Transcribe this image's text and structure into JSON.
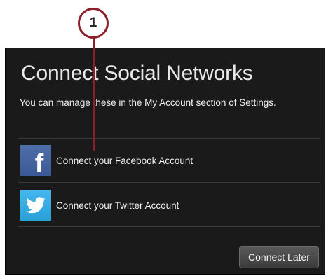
{
  "callout": {
    "number": "1",
    "color": "#8b1f2a"
  },
  "dialog": {
    "title": "Connect Social Networks",
    "subtitle": "You can manage these in the My Account section of Settings.",
    "items": [
      {
        "label": "Connect your Facebook Account",
        "icon": "facebook-icon",
        "color": "#3b5998"
      },
      {
        "label": "Connect your Twitter Account",
        "icon": "twitter-icon",
        "color": "#2aa0d8"
      }
    ],
    "connect_later_label": "Connect Later"
  }
}
